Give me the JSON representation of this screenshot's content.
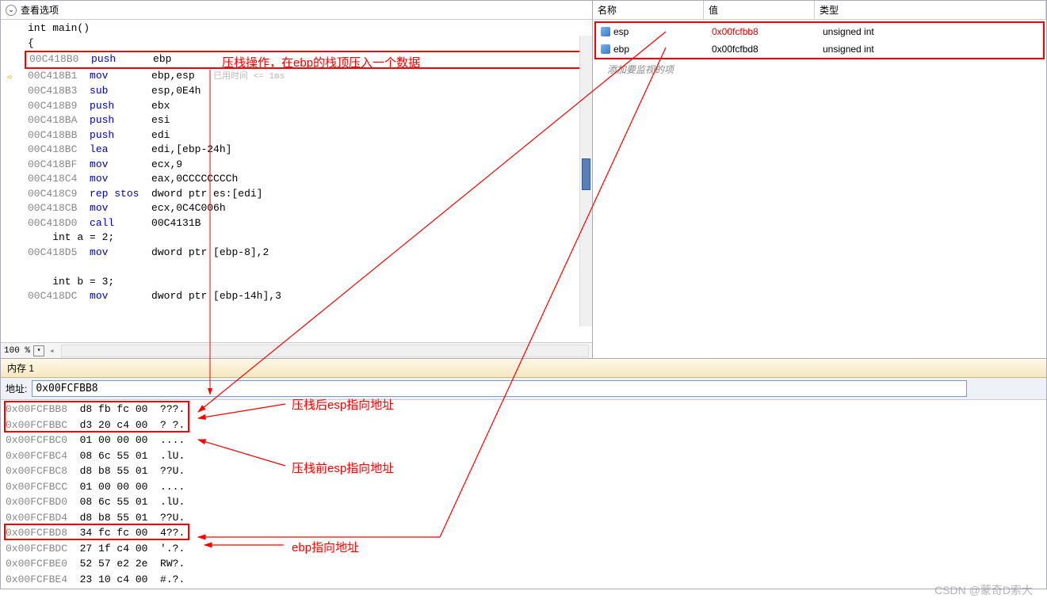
{
  "code_header": {
    "title": "查看选项"
  },
  "code": {
    "lines": [
      {
        "kind": "src",
        "text": "int main()"
      },
      {
        "kind": "src",
        "text": "{"
      },
      {
        "kind": "asm",
        "addr": "00C418B0",
        "mnem": "push",
        "ops": "ebp",
        "hl": true
      },
      {
        "kind": "asm",
        "addr": "00C418B1",
        "mnem": "mov",
        "ops": "ebp,esp",
        "cursor": true,
        "timing": "已用时间 <= 1ms"
      },
      {
        "kind": "asm",
        "addr": "00C418B3",
        "mnem": "sub",
        "ops": "esp,0E4h"
      },
      {
        "kind": "asm",
        "addr": "00C418B9",
        "mnem": "push",
        "ops": "ebx"
      },
      {
        "kind": "asm",
        "addr": "00C418BA",
        "mnem": "push",
        "ops": "esi"
      },
      {
        "kind": "asm",
        "addr": "00C418BB",
        "mnem": "push",
        "ops": "edi"
      },
      {
        "kind": "asm",
        "addr": "00C418BC",
        "mnem": "lea",
        "ops": "edi,[ebp-24h]"
      },
      {
        "kind": "asm",
        "addr": "00C418BF",
        "mnem": "mov",
        "ops": "ecx,9"
      },
      {
        "kind": "asm",
        "addr": "00C418C4",
        "mnem": "mov",
        "ops": "eax,0CCCCCCCCh"
      },
      {
        "kind": "asm",
        "addr": "00C418C9",
        "mnem": "rep stos",
        "ops": "dword ptr es:[edi]"
      },
      {
        "kind": "asm",
        "addr": "00C418CB",
        "mnem": "mov",
        "ops": "ecx,0C4C006h"
      },
      {
        "kind": "asm",
        "addr": "00C418D0",
        "mnem": "call",
        "ops": "00C4131B"
      },
      {
        "kind": "src",
        "text": "    int a = 2;"
      },
      {
        "kind": "asm",
        "addr": "00C418D5",
        "mnem": "mov",
        "ops": "dword ptr [ebp-8],2"
      },
      {
        "kind": "blank"
      },
      {
        "kind": "src",
        "text": "    int b = 3;"
      },
      {
        "kind": "asm",
        "addr": "00C418DC",
        "mnem": "mov",
        "ops": "dword ptr [ebp-14h],3"
      }
    ]
  },
  "zoom": {
    "value": "100 %"
  },
  "watch": {
    "headers": {
      "name": "名称",
      "value": "值",
      "type": "类型"
    },
    "rows": [
      {
        "name": "esp",
        "value": "0x00fcfbb8",
        "type": "unsigned int",
        "red": true
      },
      {
        "name": "ebp",
        "value": "0x00fcfbd8",
        "type": "unsigned int"
      }
    ],
    "placeholder": "添加要监视的项"
  },
  "memory": {
    "title": "内存 1",
    "addr_label": "地址:",
    "addr_value": "0x00FCFBB8",
    "rows": [
      {
        "addr": "0x00FCFBB8",
        "bytes": "d8 fb fc 00",
        "ascii": "???."
      },
      {
        "addr": "0x00FCFBBC",
        "bytes": "d3 20 c4 00",
        "ascii": "? ?."
      },
      {
        "addr": "0x00FCFBC0",
        "bytes": "01 00 00 00",
        "ascii": "...."
      },
      {
        "addr": "0x00FCFBC4",
        "bytes": "08 6c 55 01",
        "ascii": ".lU."
      },
      {
        "addr": "0x00FCFBC8",
        "bytes": "d8 b8 55 01",
        "ascii": "??U."
      },
      {
        "addr": "0x00FCFBCC",
        "bytes": "01 00 00 00",
        "ascii": "...."
      },
      {
        "addr": "0x00FCFBD0",
        "bytes": "08 6c 55 01",
        "ascii": ".lU."
      },
      {
        "addr": "0x00FCFBD4",
        "bytes": "d8 b8 55 01",
        "ascii": "??U."
      },
      {
        "addr": "0x00FCFBD8",
        "bytes": "34 fc fc 00",
        "ascii": "4??."
      },
      {
        "addr": "0x00FCFBDC",
        "bytes": "27 1f c4 00",
        "ascii": "'.?."
      },
      {
        "addr": "0x00FCFBE0",
        "bytes": "52 57 e2 2e",
        "ascii": "RW?."
      },
      {
        "addr": "0x00FCFBE4",
        "bytes": "23 10 c4 00",
        "ascii": "#.?."
      }
    ]
  },
  "annotations": {
    "a1": "压栈操作，在ebp的栈顶压入一个数据",
    "a2": "压栈后esp指向地址",
    "a3": "压栈前esp指向地址",
    "a4": "ebp指向地址"
  },
  "watermark": "CSDN @蒙奇D索大"
}
